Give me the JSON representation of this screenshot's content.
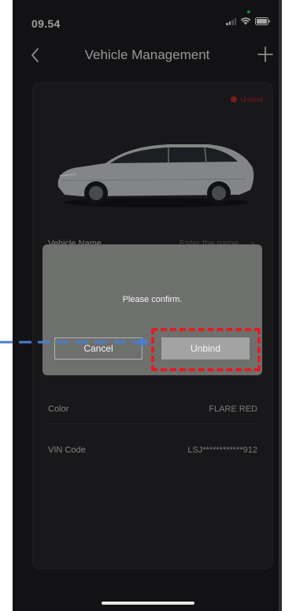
{
  "status_bar": {
    "time": "09.54"
  },
  "header": {
    "title": "Vehicle Management",
    "back_icon": "chevron-left-icon",
    "add_icon": "plus-icon"
  },
  "card": {
    "unbind_label": "Unbind",
    "fields": [
      {
        "label": "Vehicle Name",
        "placeholder": "Enter the name"
      },
      {
        "label": "Color",
        "value": "FLARE RED"
      },
      {
        "label": "VIN Code",
        "value": "LSJ************912"
      }
    ]
  },
  "dialog": {
    "message": "Please confirm.",
    "cancel_label": "Cancel",
    "unbind_label": "Unbind"
  },
  "colors": {
    "background": "#1c1d20",
    "card": "#252629",
    "accent_red": "#c0282a",
    "annotation_blue": "#4a7cd1",
    "annotation_red": "#e01e25"
  }
}
